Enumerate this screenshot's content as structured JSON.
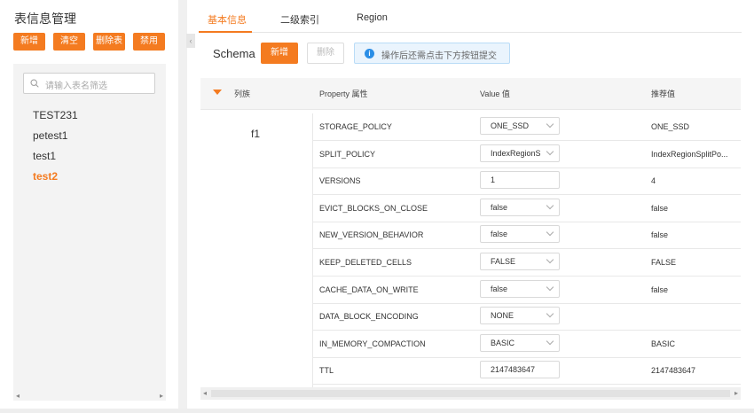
{
  "left_panel": {
    "title": "表信息管理",
    "buttons": {
      "add": "新增",
      "clear": "清空",
      "delete_table": "删除表",
      "disable": "禁用"
    },
    "search_placeholder": "请输入表名筛选",
    "tables": [
      "TEST231",
      "petest1",
      "test1",
      "test2"
    ],
    "active_table": "test2"
  },
  "tabs": [
    "基本信息",
    "二级索引",
    "Region"
  ],
  "active_tab": "基本信息",
  "schema": {
    "label": "Schema",
    "add_label": "新增",
    "delete_label": "删除",
    "notice": "操作后还需点击下方按钮提交"
  },
  "grid": {
    "headers": {
      "family": "列族",
      "property": "Property 属性",
      "value": "Value 值",
      "recommended": "推荐值"
    },
    "family_name": "f1",
    "rows": [
      {
        "property": "STORAGE_POLICY",
        "value": "ONE_SSD",
        "control": "select",
        "recommended": "ONE_SSD"
      },
      {
        "property": "SPLIT_POLICY",
        "value": "IndexRegionS",
        "control": "select",
        "recommended": "IndexRegionSplitPo..."
      },
      {
        "property": "VERSIONS",
        "value": "1",
        "control": "input",
        "recommended": "4"
      },
      {
        "property": "EVICT_BLOCKS_ON_CLOSE",
        "value": "false",
        "control": "select",
        "recommended": "false"
      },
      {
        "property": "NEW_VERSION_BEHAVIOR",
        "value": "false",
        "control": "select",
        "recommended": "false"
      },
      {
        "property": "KEEP_DELETED_CELLS",
        "value": "FALSE",
        "control": "select",
        "recommended": "FALSE"
      },
      {
        "property": "CACHE_DATA_ON_WRITE",
        "value": "false",
        "control": "select",
        "recommended": "false"
      },
      {
        "property": "DATA_BLOCK_ENCODING",
        "value": "NONE",
        "control": "select",
        "recommended": ""
      },
      {
        "property": "IN_MEMORY_COMPACTION",
        "value": "BASIC",
        "control": "select",
        "recommended": "BASIC"
      },
      {
        "property": "TTL",
        "value": "2147483647",
        "control": "input",
        "recommended": "2147483647"
      }
    ]
  },
  "colors": {
    "accent": "#f47b20",
    "info": "#2b8ee6"
  }
}
